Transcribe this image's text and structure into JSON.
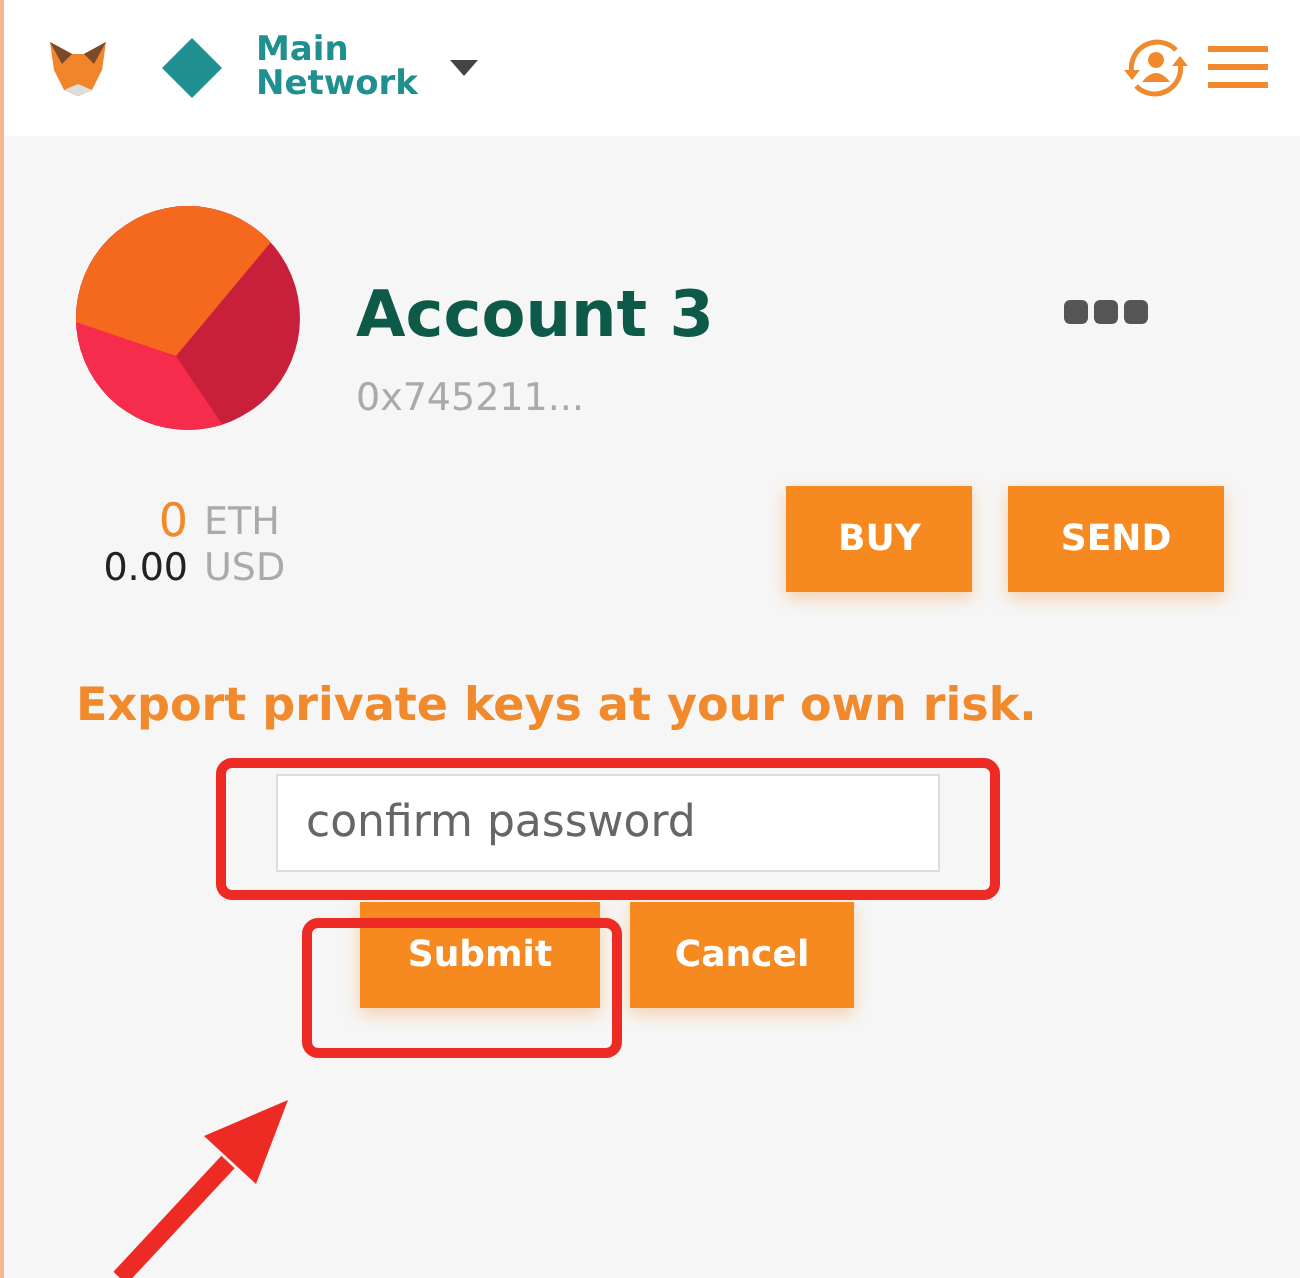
{
  "header": {
    "network": "Main\nNetwork"
  },
  "account": {
    "name": "Account 3",
    "address": "0x745211..."
  },
  "balance": {
    "amount": "0",
    "unit": "ETH",
    "fiat": "0.00",
    "fiat_unit": "USD"
  },
  "actions": [
    "BUY",
    "SEND"
  ],
  "warning": "Export private keys at your own risk.",
  "password": {
    "placeholder": "confirm password",
    "highlighted": true
  },
  "form_buttons": [
    {
      "label": "Submit",
      "highlighted": true
    },
    {
      "label": "Cancel",
      "highlighted": false
    }
  ]
}
